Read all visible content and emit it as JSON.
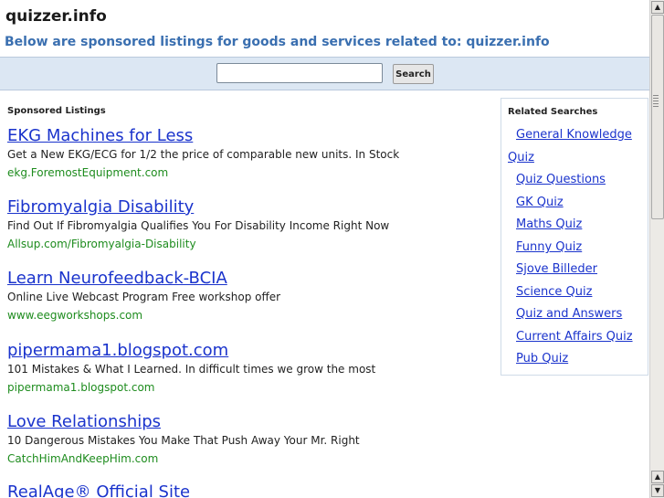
{
  "header": {
    "site_title": "quizzer.info",
    "subtitle": "Below are sponsored listings for goods and services related to: quizzer.info"
  },
  "search": {
    "value": "",
    "button_label": "Search"
  },
  "sponsored": {
    "heading": "Sponsored Listings",
    "ads": [
      {
        "title": "EKG Machines for Less",
        "desc": "Get a New EKG/ECG for 1/2 the price of comparable new units. In Stock",
        "url": "ekg.ForemostEquipment.com"
      },
      {
        "title": "Fibromyalgia Disability",
        "desc": "Find Out If Fibromyalgia Qualifies You For Disability Income Right Now",
        "url": "Allsup.com/Fibromyalgia-Disability"
      },
      {
        "title": "Learn Neurofeedback-BCIA",
        "desc": "Online Live Webcast Program Free workshop offer",
        "url": "www.eegworkshops.com"
      },
      {
        "title": "pipermama1.blogspot.com",
        "desc": "101 Mistakes & What I Learned. In difficult times we grow the most",
        "url": "pipermama1.blogspot.com"
      },
      {
        "title": "Love Relationships",
        "desc": "10 Dangerous Mistakes You Make That Push Away Your Mr. Right",
        "url": "CatchHimAndKeepHim.com"
      },
      {
        "title": "RealAge® Official Site",
        "desc": "",
        "url": ""
      }
    ]
  },
  "related": {
    "heading": "Related Searches",
    "general_knowledge_line1": "General Knowledge",
    "general_knowledge_line2": "Quiz",
    "links": [
      "Quiz Questions",
      "GK Quiz",
      "Maths Quiz",
      "Funny Quiz",
      "Sjove Billeder",
      "Science Quiz",
      "Quiz and Answers",
      "Current Affairs Quiz",
      "Pub Quiz"
    ]
  },
  "scrollbar": {
    "up_icon": "arrow-up-icon",
    "down_icon": "arrow-down-icon"
  },
  "colors": {
    "link": "#1a33cc",
    "url_green": "#1e8c1e",
    "subtitle_blue": "#3a6fb0",
    "search_band": "#dce7f3"
  }
}
